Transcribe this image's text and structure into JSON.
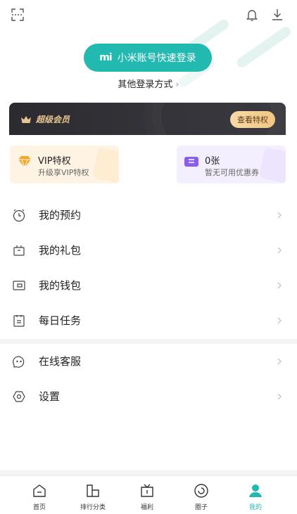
{
  "header": {
    "scan_icon": "scan-icon",
    "bell_icon": "bell-icon",
    "download_icon": "download-icon"
  },
  "login": {
    "mi_logo": "mi",
    "quick_login_label": "小米账号快速登录",
    "other_login_label": "其他登录方式",
    "chevron": "›"
  },
  "vip_banner": {
    "title": "超级会员",
    "button_label": "查看特权"
  },
  "perks": [
    {
      "title": "VIP特权",
      "subtitle": "升级享VIP特权"
    },
    {
      "title": "0张",
      "subtitle": "暂无可用优惠券"
    }
  ],
  "menu_primary": [
    {
      "label": "我的预约",
      "icon": "clock-icon"
    },
    {
      "label": "我的礼包",
      "icon": "gift-icon"
    },
    {
      "label": "我的钱包",
      "icon": "wallet-icon"
    },
    {
      "label": "每日任务",
      "icon": "task-icon"
    }
  ],
  "menu_secondary": [
    {
      "label": "在线客服",
      "icon": "chat-icon"
    },
    {
      "label": "设置",
      "icon": "settings-icon"
    }
  ],
  "tabs": [
    {
      "label": "首页",
      "icon": "home-icon"
    },
    {
      "label": "排行分类",
      "icon": "ranking-icon"
    },
    {
      "label": "福利",
      "icon": "welfare-icon"
    },
    {
      "label": "圈子",
      "icon": "circle-icon"
    },
    {
      "label": "我的",
      "icon": "profile-icon",
      "active": true
    }
  ],
  "colors": {
    "accent": "#22b9b0",
    "vip_gold": "#e9c591",
    "vip_dark": "#2b2b30"
  }
}
